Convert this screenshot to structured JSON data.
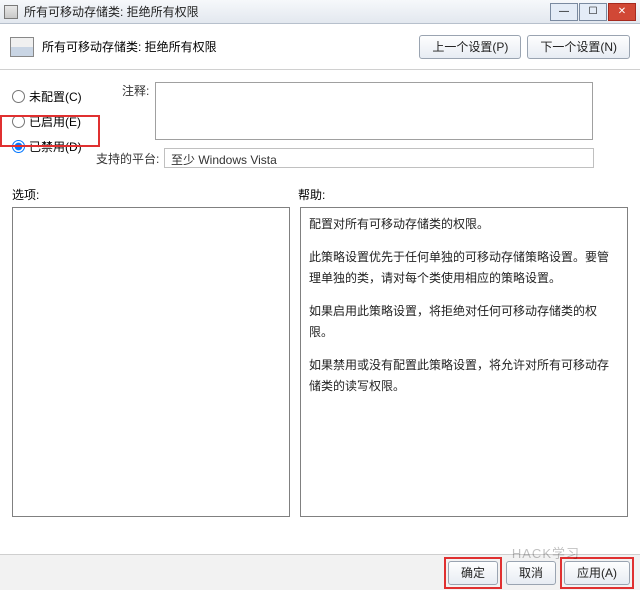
{
  "titlebar": {
    "title": "所有可移动存储类: 拒绝所有权限"
  },
  "header": {
    "title": "所有可移动存储类: 拒绝所有权限",
    "prev": "上一个设置(P)",
    "next": "下一个设置(N)"
  },
  "radios": {
    "not_configured": "未配置(C)",
    "enabled": "已启用(E)",
    "disabled": "已禁用(D)",
    "selected": "disabled"
  },
  "comment": {
    "label": "注释:",
    "value": ""
  },
  "platform": {
    "label": "支持的平台:",
    "value": "至少 Windows Vista"
  },
  "panes": {
    "options_label": "选项:",
    "help_label": "帮助:"
  },
  "help": {
    "p1": "配置对所有可移动存储类的权限。",
    "p2": "此策略设置优先于任何单独的可移动存储策略设置。要管理单独的类，请对每个类使用相应的策略设置。",
    "p3": "如果启用此策略设置，将拒绝对任何可移动存储类的权限。",
    "p4": "如果禁用或没有配置此策略设置，将允许对所有可移动存储类的读写权限。"
  },
  "buttons": {
    "ok": "确定",
    "cancel": "取消",
    "apply": "应用(A)"
  },
  "watermark": "HACK学习"
}
